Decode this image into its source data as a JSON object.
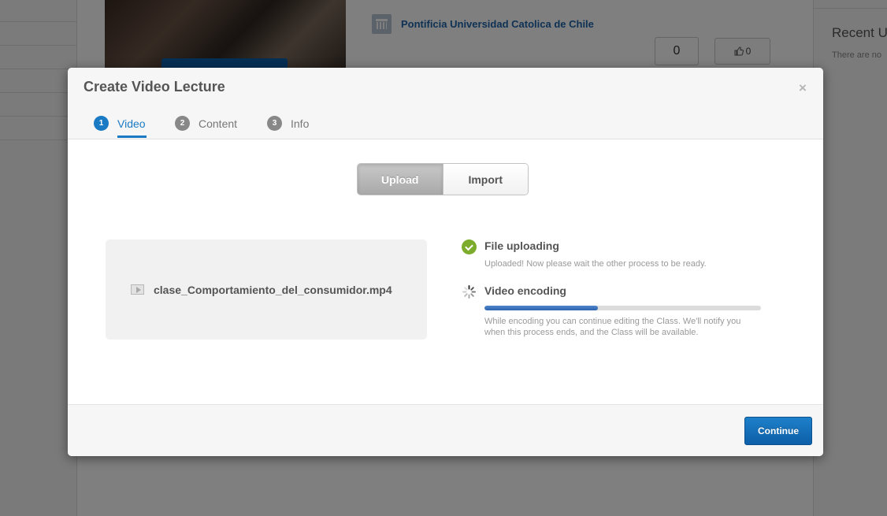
{
  "background": {
    "institution_name": "Pontificia Universidad Catolica de Chile",
    "comment_count": "0",
    "like_count": "0",
    "recent_heading": "Recent Us",
    "recent_empty": "There are no"
  },
  "modal": {
    "title": "Create Video Lecture",
    "close_label": "×",
    "steps": [
      {
        "number": "1",
        "label": "Video",
        "active": true
      },
      {
        "number": "2",
        "label": "Content",
        "active": false
      },
      {
        "number": "3",
        "label": "Info",
        "active": false
      }
    ],
    "source_toggle": {
      "upload_label": "Upload",
      "import_label": "Import",
      "selected": "Upload"
    },
    "file": {
      "name": "clase_Comportamiento_del_consumidor.mp4",
      "icon": "video-file-icon"
    },
    "upload_status": {
      "icon": "check-circle-icon",
      "title": "File uploading",
      "description": "Uploaded! Now please wait the other process to be ready."
    },
    "encoding_status": {
      "icon": "spinner-icon",
      "title": "Video encoding",
      "progress_percent": 41,
      "description_line1": "While encoding you can continue editing the Class. We'll notify you",
      "description_line2": "when this process ends, and the Class will be available."
    },
    "continue_label": "Continue"
  },
  "colors": {
    "accent": "#1a7ac4",
    "success": "#7dab2b",
    "progress": "#2d63ad",
    "primary_button": "#0d5fa8"
  }
}
